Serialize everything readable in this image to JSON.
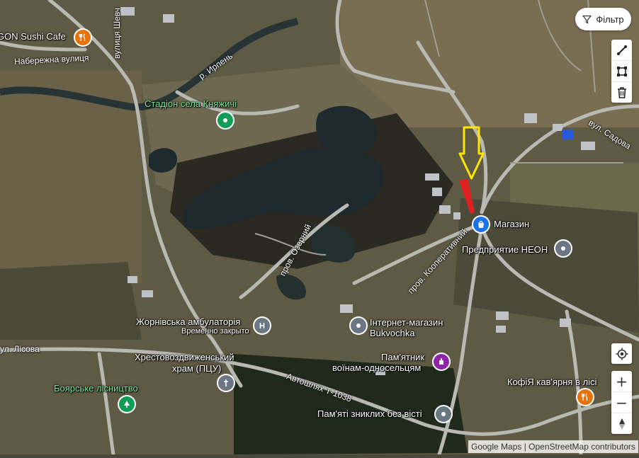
{
  "map": {
    "places": [
      {
        "label": "GON Sushi Cafe",
        "sublabel": ""
      },
      {
        "label": "Стадіон села Княжичі",
        "sublabel": ""
      },
      {
        "label": "Магазин",
        "sublabel": ""
      },
      {
        "label": "Предприятие НЕОН",
        "sublabel": ""
      },
      {
        "label": "Жорнівська амбулаторія",
        "sublabel": "Временно закрыто"
      },
      {
        "label": "Інтернет-магазин",
        "sublabel": "Bukvochka"
      },
      {
        "label": "Хрестовоздвиженський",
        "sublabel": "храм (ПЦУ)"
      },
      {
        "label": "Пам'ятник",
        "sublabel": "воїнам-односельцям"
      },
      {
        "label": "Боярське лісництво",
        "sublabel": ""
      },
      {
        "label": "КофіЯ кав'ярня в лісі",
        "sublabel": ""
      },
      {
        "label": "Пам'яті зниклих без вісті",
        "sublabel": ""
      }
    ],
    "roads": {
      "naberezhna": "Набережна вулиця",
      "shevchenka": "вулиця Шевч",
      "irpen": "р. Ирпень",
      "sadova": "вул. Садова",
      "ozernyi": "пров. Озерний",
      "kooperatyvnyi": "пров. Кооперативний",
      "lisova": "ул. Лісова",
      "avtoshliakh": "Автошлях Т-1038"
    },
    "icon_colors": {
      "restaurant": "#e8710a",
      "park": "#0f9d58",
      "shop": "#1a73e8",
      "generic": "#6b7783",
      "church": "#6b7783",
      "monument": "#8e24aa",
      "marker_arrow": "#ffe600",
      "red_marker": "#e02020"
    }
  },
  "controls": {
    "filter_label": "Фільтр",
    "tools": [
      "line-tool-icon",
      "rectangle-tool-icon",
      "trash-icon"
    ],
    "zoom_in": "+",
    "zoom_out": "−"
  },
  "attribution": {
    "google": "Google Maps",
    "separator": " | ",
    "osm": "OpenStreetMap contributors"
  }
}
